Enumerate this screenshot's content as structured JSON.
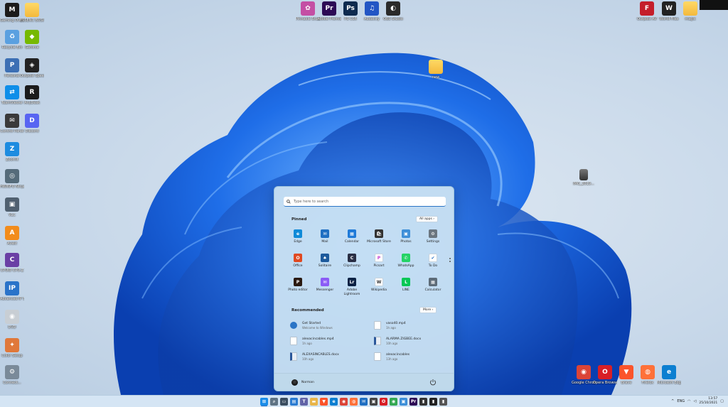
{
  "desktop": {
    "left_icons": [
      {
        "label": "Gaming Overwo...",
        "icon": "gaming-app-icon",
        "color": "#1b1b1b",
        "glyph": "M"
      },
      {
        "label": "Recycle Bin",
        "icon": "recycle-bin-icon",
        "color": "#5aa0e0",
        "glyph": "♻"
      },
      {
        "label": "Personal",
        "icon": "personal-tools-icon",
        "color": "#3c6fb4",
        "glyph": "P"
      },
      {
        "label": "TeamViewer",
        "icon": "teamviewer-icon",
        "color": "#0e8ee9",
        "glyph": "⇄"
      },
      {
        "label": "Control Panel",
        "icon": "control-panel-icon",
        "color": "#3a3a3a",
        "glyph": "✉"
      },
      {
        "label": "Zoomit",
        "icon": "zoom-icon",
        "color": "#1d8ce0",
        "glyph": "Z"
      },
      {
        "label": "HWiNFO Ninja...",
        "icon": "hwinfo-icon",
        "color": "#556b7a",
        "glyph": "◎"
      },
      {
        "label": "VLC",
        "icon": "network-icon",
        "color": "#506070",
        "glyph": "▣"
      },
      {
        "label": "Avast",
        "icon": "avast-icon",
        "color": "#f28c1c",
        "glyph": "A"
      },
      {
        "label": "CPUID CPU-Z",
        "icon": "cpuz-icon",
        "color": "#6a3fa5",
        "glyph": "C"
      },
      {
        "label": "Advanced IP Scanner",
        "icon": "ip-scanner-icon",
        "color": "#2a73c9",
        "glyph": "IP"
      },
      {
        "label": "DVD",
        "icon": "dvd-icon",
        "color": "#c8ced4",
        "glyph": "◉"
      },
      {
        "label": "Color Setup",
        "icon": "color-setup-icon",
        "color": "#e0783a",
        "glyph": "✦"
      },
      {
        "label": "Connect...",
        "icon": "connect-icon",
        "color": "#7a8a99",
        "glyph": "⚙"
      }
    ],
    "second_column_icons": [
      {
        "label": "ESSENC BUSINESS",
        "icon": "folder-icon"
      },
      {
        "label": "Geforce",
        "icon": "geforce-icon",
        "color": "#76b900",
        "glyph": "◆"
      },
      {
        "label": "Outpost Speed",
        "icon": "outpost-icon",
        "color": "#222",
        "glyph": "◈"
      },
      {
        "label": "AnyDesk",
        "icon": "anydesk-icon",
        "color": "#1b1b1b",
        "glyph": "R"
      },
      {
        "label": "Discord",
        "icon": "discord-icon",
        "color": "#5865f2",
        "glyph": "D"
      }
    ],
    "top_icons": [
      {
        "label": "Pinnacle Studio 25",
        "icon": "pinnacle-icon",
        "color": "#c44fa4",
        "glyph": "✿"
      },
      {
        "label": "Adobe Premiere P...",
        "icon": "premiere-icon",
        "color": "#2d0a55",
        "glyph": "Pr"
      },
      {
        "label": "PS CS6",
        "icon": "photoshop-icon",
        "color": "#0e2a4f",
        "glyph": "Ps"
      },
      {
        "label": "Audacity",
        "icon": "audacity-icon",
        "color": "#2255c4",
        "glyph": "♫"
      },
      {
        "label": "OBS Studio",
        "icon": "obs-icon",
        "color": "#2a2a2a",
        "glyph": "◐"
      }
    ],
    "top_right_icons": [
      {
        "label": "Outpost AV",
        "icon": "outpost-av-icon",
        "color": "#c41e2a",
        "glyph": "F"
      },
      {
        "label": "World Files",
        "icon": "world-files-icon",
        "color": "#222",
        "glyph": "W"
      },
      {
        "label": "magic",
        "icon": "folder-icon"
      }
    ],
    "middle_folder": {
      "label": "new"
    },
    "image_file": {
      "label": "IMG_2019..."
    },
    "bottom_right_icons": [
      {
        "label": "Google Chrome",
        "icon": "chrome-icon",
        "color": "#db4437",
        "glyph": "◉"
      },
      {
        "label": "Opera Browser",
        "icon": "opera-icon",
        "color": "#d81f26",
        "glyph": "O"
      },
      {
        "label": "Brave",
        "icon": "brave-icon",
        "color": "#fb542b",
        "glyph": "▼"
      },
      {
        "label": "Firefox",
        "icon": "firefox-icon",
        "color": "#ff7139",
        "glyph": "◍"
      },
      {
        "label": "Microsoft Edge",
        "icon": "edge-icon",
        "color": "#0c7fd1",
        "glyph": "e"
      }
    ]
  },
  "start_menu": {
    "search_placeholder": "Type here to search",
    "pinned_title": "Pinned",
    "all_apps_label": "All apps ›",
    "pinned": [
      {
        "label": "Edge",
        "icon": "edge-icon",
        "color": "#0f8ad8",
        "glyph": "e"
      },
      {
        "label": "Mail",
        "icon": "mail-icon",
        "color": "#1f6fc2",
        "glyph": "✉"
      },
      {
        "label": "Calendar",
        "icon": "calendar-icon",
        "color": "#1f7ad8",
        "glyph": "▦"
      },
      {
        "label": "Microsoft Store",
        "icon": "store-icon",
        "color": "#333",
        "glyph": "🛍"
      },
      {
        "label": "Photos",
        "icon": "photos-icon",
        "color": "#3d8fd8",
        "glyph": "▣"
      },
      {
        "label": "Settings",
        "icon": "settings-icon",
        "color": "#6b7680",
        "glyph": "⚙"
      },
      {
        "label": "Office",
        "icon": "office-icon",
        "color": "#e04a22",
        "glyph": "O"
      },
      {
        "label": "Solitaire",
        "icon": "solitaire-icon",
        "color": "#1c5a9c",
        "glyph": "♠"
      },
      {
        "label": "Clipchamp",
        "icon": "clipchamp-icon",
        "color": "#2a2f45",
        "glyph": "C"
      },
      {
        "label": "Picsart",
        "icon": "picsart-icon",
        "color": "#ffffff",
        "glyph": "P",
        "fg": "#c43fd2"
      },
      {
        "label": "WhatsApp",
        "icon": "whatsapp-icon",
        "color": "#25d366",
        "glyph": "✆"
      },
      {
        "label": "To Do",
        "icon": "todo-icon",
        "color": "#ffffff",
        "glyph": "✔",
        "fg": "#2a74c6"
      },
      {
        "label": "Photo editor",
        "icon": "photo-editor-icon",
        "color": "#2a1a12",
        "glyph": "P"
      },
      {
        "label": "Messenger",
        "icon": "messenger-icon",
        "color": "#8b5cf6",
        "glyph": "✉"
      },
      {
        "label": "Adobe Lightroom",
        "icon": "lightroom-icon",
        "color": "#0c2244",
        "glyph": "Lr"
      },
      {
        "label": "Wikipedia",
        "icon": "wikipedia-icon",
        "color": "#ffffff",
        "glyph": "W",
        "fg": "#333"
      },
      {
        "label": "LINE",
        "icon": "line-icon",
        "color": "#06c755",
        "glyph": "L"
      },
      {
        "label": "Calculator",
        "icon": "calculator-icon",
        "color": "#5d6b78",
        "glyph": "▦"
      }
    ],
    "recommended_title": "Recommended",
    "more_label": "More ›",
    "recommended": [
      {
        "title": "Get Started",
        "sub": "Welcome to Windows",
        "icon": "get-started-icon"
      },
      {
        "title": "vaso40.mp4",
        "sub": "1h ago",
        "icon": "file-icon"
      },
      {
        "title": "alexacincables.mp4",
        "sub": "1h ago",
        "icon": "file-icon"
      },
      {
        "title": "ALARMA ZIGBEE.docx",
        "sub": "10h ago",
        "icon": "doc-icon"
      },
      {
        "title": "ALEXASINCABLES.docx",
        "sub": "10h ago",
        "icon": "doc-icon"
      },
      {
        "title": "alexacincables",
        "sub": "13h ago",
        "icon": "file-icon"
      }
    ],
    "user_name": "Norman"
  },
  "taskbar": {
    "apps": [
      {
        "icon": "start-icon",
        "color": "#1a8ce8",
        "glyph": "⊞"
      },
      {
        "icon": "search-icon",
        "color": "#5f7384",
        "glyph": "⌕"
      },
      {
        "icon": "task-view-icon",
        "color": "#3a4d60",
        "glyph": "▭"
      },
      {
        "icon": "widgets-icon",
        "color": "#2a7bd1",
        "glyph": "▤"
      },
      {
        "icon": "teams-chat-icon",
        "color": "#6264a7",
        "glyph": "T"
      },
      {
        "icon": "file-explorer-icon",
        "color": "#e8b54a",
        "glyph": "▬"
      },
      {
        "icon": "brave-icon",
        "color": "#fb542b",
        "glyph": "▼"
      },
      {
        "icon": "edge-icon",
        "color": "#0c7fd1",
        "glyph": "e"
      },
      {
        "icon": "chrome-icon",
        "color": "#db4437",
        "glyph": "◉"
      },
      {
        "icon": "firefox-icon",
        "color": "#ff7139",
        "glyph": "◍"
      },
      {
        "icon": "mail-icon",
        "color": "#1f6fc2",
        "glyph": "✉"
      },
      {
        "icon": "store-icon",
        "color": "#444",
        "glyph": "▣"
      },
      {
        "icon": "opera-icon",
        "color": "#d81f26",
        "glyph": "O"
      },
      {
        "icon": "chrome-icon",
        "color": "#34a853",
        "glyph": "◉"
      },
      {
        "icon": "photos-icon",
        "color": "#3d8fd8",
        "glyph": "▣"
      },
      {
        "icon": "premiere-icon",
        "color": "#2d0a55",
        "glyph": "Pr"
      },
      {
        "icon": "terminal-icon",
        "color": "#333",
        "glyph": "▮"
      },
      {
        "icon": "terminal-icon",
        "color": "#222",
        "glyph": "▮"
      },
      {
        "icon": "app-icon",
        "color": "#555",
        "glyph": "▮"
      }
    ],
    "tray": {
      "chevron": "^",
      "language": "ENG",
      "time": "13:57",
      "date": "25/10/2021"
    }
  }
}
